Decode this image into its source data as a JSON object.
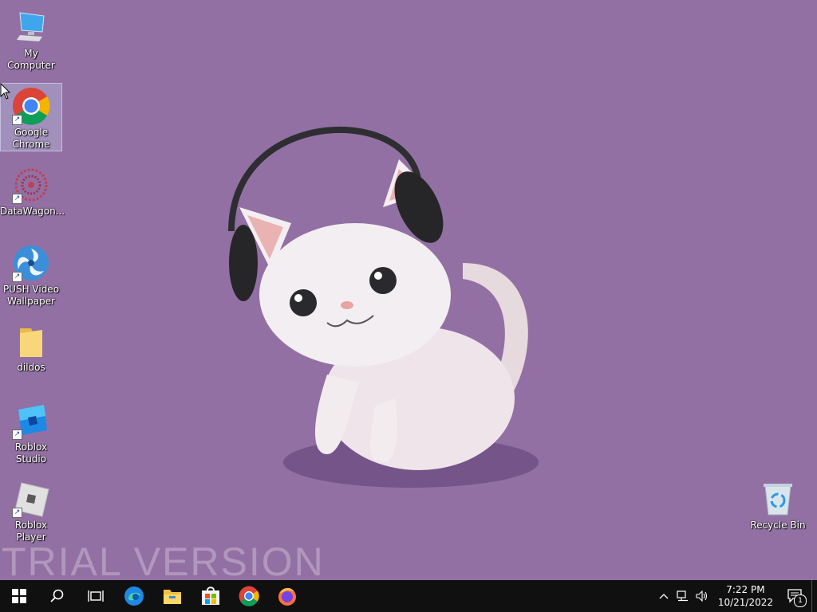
{
  "desktop": {
    "icons": [
      {
        "label": "My Computer",
        "icon": "computer-icon"
      },
      {
        "label": "Google Chrome",
        "icon": "chrome-icon"
      },
      {
        "label": "DataWagon...",
        "icon": "datawagon-icon"
      },
      {
        "label": "PUSH Video Wallpaper",
        "icon": "push-video-wallpaper-icon"
      },
      {
        "label": "dildos",
        "icon": "folder-icon"
      },
      {
        "label": "Roblox Studio",
        "icon": "roblox-studio-icon"
      },
      {
        "label": "Roblox Player",
        "icon": "roblox-player-icon"
      },
      {
        "label": "Recycle Bin",
        "icon": "recycle-bin-icon"
      }
    ],
    "watermark": "TRIAL VERSION",
    "background_color": "#9370a3"
  },
  "taskbar": {
    "items": [
      "start-icon",
      "search-icon",
      "task-view-icon",
      "edge-icon",
      "file-explorer-icon",
      "microsoft-store-icon",
      "chrome-icon",
      "firefox-icon"
    ],
    "clock": {
      "time": "7:22 PM",
      "date": "10/21/2022"
    },
    "notification_count": "1"
  }
}
